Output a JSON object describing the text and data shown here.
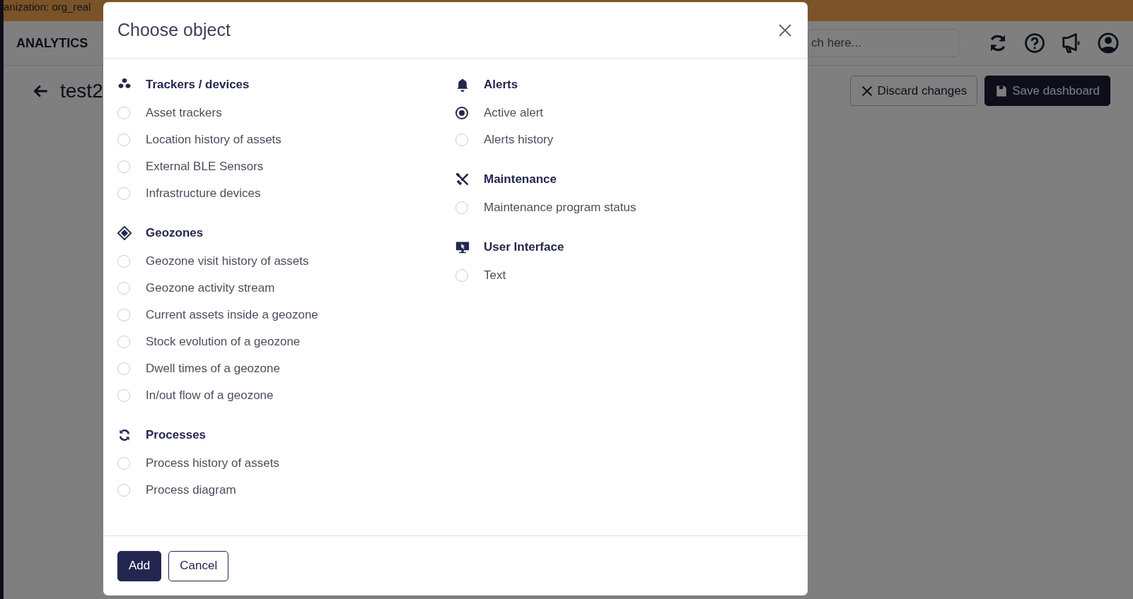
{
  "top_bar": {
    "text": "anization: org_real"
  },
  "header": {
    "title": "ANALYTICS",
    "search": {
      "placeholder": "ch here..."
    }
  },
  "page": {
    "title": "test2",
    "actions": [
      {
        "label": "Discard changes",
        "kind": "discard"
      },
      {
        "label": "Save dashboard",
        "kind": "save"
      }
    ]
  },
  "dialog": {
    "title": "Choose object",
    "columns": [
      {
        "groups": [
          {
            "title": "Trackers / devices",
            "kind": "cubes",
            "items": [
              {
                "label": "Asset trackers",
                "selected": false
              },
              {
                "label": "Location history of assets",
                "selected": false
              },
              {
                "label": "External BLE Sensors",
                "selected": false
              },
              {
                "label": "Infrastructure devices",
                "selected": false
              }
            ]
          },
          {
            "title": "Geozones",
            "kind": "geozone",
            "items": [
              {
                "label": "Geozone visit history of assets",
                "selected": false
              },
              {
                "label": "Geozone activity stream",
                "selected": false
              },
              {
                "label": "Current assets inside a geozone",
                "selected": false
              },
              {
                "label": "Stock evolution of a geozone",
                "selected": false
              },
              {
                "label": "Dwell times of a geozone",
                "selected": false
              },
              {
                "label": "In/out flow of a geozone",
                "selected": false
              }
            ]
          },
          {
            "title": "Processes",
            "kind": "process",
            "items": [
              {
                "label": "Process history of assets",
                "selected": false
              },
              {
                "label": "Process diagram",
                "selected": false
              }
            ]
          }
        ]
      },
      {
        "groups": [
          {
            "title": "Alerts",
            "kind": "bell",
            "items": [
              {
                "label": "Active alert",
                "selected": true
              },
              {
                "label": "Alerts history",
                "selected": false
              }
            ]
          },
          {
            "title": "Maintenance",
            "kind": "tools",
            "items": [
              {
                "label": "Maintenance program status",
                "selected": false
              }
            ]
          },
          {
            "title": "User Interface",
            "kind": "monitor",
            "items": [
              {
                "label": "Text",
                "selected": false
              }
            ]
          }
        ]
      }
    ],
    "buttons": [
      {
        "label": "Add",
        "kind": "primary"
      },
      {
        "label": "Cancel",
        "kind": "secondary"
      }
    ]
  }
}
